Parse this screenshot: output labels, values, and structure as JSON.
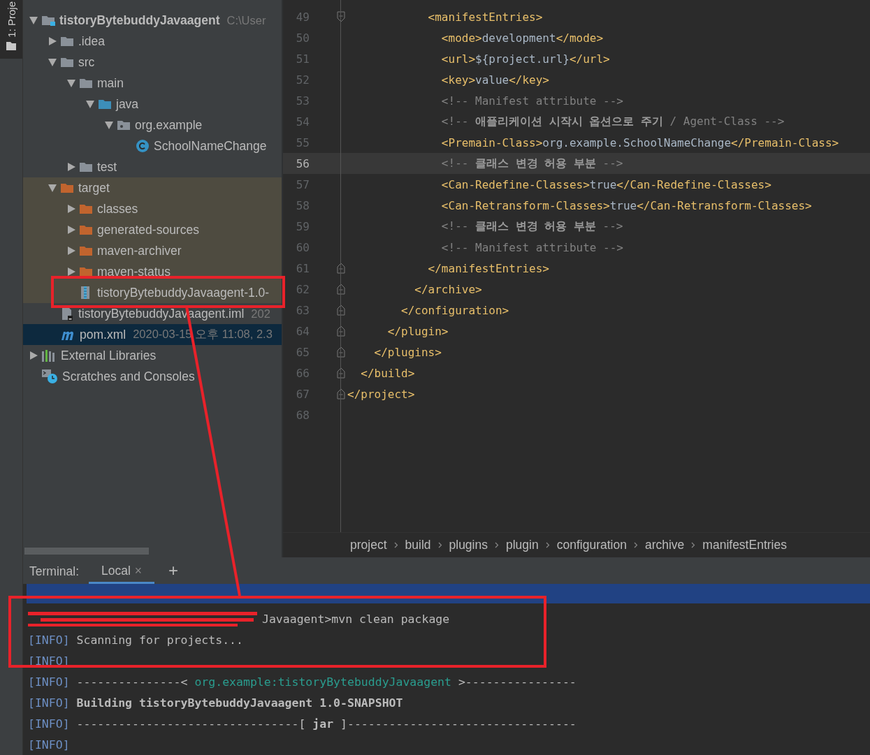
{
  "tool_stripe": {
    "label": "1: Proje"
  },
  "project_tree": [
    {
      "label": "tistoryBytebuddyJavaagent",
      "kind": "module",
      "hint": "C:\\User",
      "expanded": true,
      "selected": false,
      "excluded": false,
      "children": [
        {
          "label": ".idea",
          "kind": "folder",
          "expanded": false,
          "selected": false,
          "excluded": false
        },
        {
          "label": "src",
          "kind": "folder",
          "expanded": true,
          "selected": false,
          "excluded": false,
          "children": [
            {
              "label": "main",
              "kind": "folder",
              "expanded": true,
              "selected": false,
              "excluded": false,
              "children": [
                {
                  "label": "java",
                  "kind": "source",
                  "expanded": true,
                  "selected": false,
                  "excluded": false,
                  "children": [
                    {
                      "label": "org.example",
                      "kind": "package",
                      "expanded": true,
                      "selected": false,
                      "excluded": false,
                      "children": [
                        {
                          "label": "SchoolNameChange",
                          "kind": "class",
                          "selected": false,
                          "excluded": false
                        }
                      ]
                    }
                  ]
                }
              ]
            },
            {
              "label": "test",
              "kind": "folder",
              "expanded": false,
              "selected": false,
              "excluded": false
            }
          ]
        },
        {
          "label": "target",
          "kind": "folder",
          "expanded": true,
          "selected": false,
          "excluded": true,
          "children": [
            {
              "label": "classes",
              "kind": "folder",
              "expanded": false,
              "selected": false,
              "excluded": true
            },
            {
              "label": "generated-sources",
              "kind": "folder",
              "expanded": false,
              "selected": false,
              "excluded": true
            },
            {
              "label": "maven-archiver",
              "kind": "folder",
              "expanded": false,
              "selected": false,
              "excluded": true
            },
            {
              "label": "maven-status",
              "kind": "folder",
              "expanded": false,
              "selected": false,
              "excluded": true
            },
            {
              "label": "tistoryBytebuddyJavaagent-1.0-",
              "kind": "jar",
              "selected": false,
              "excluded": true
            }
          ]
        },
        {
          "label": "tistoryBytebuddyJavaagent.iml",
          "kind": "iml",
          "hint": "202",
          "selected": false,
          "excluded": false
        },
        {
          "label": "pom.xml",
          "kind": "maven",
          "hint": "2020-03-15 오후 11:08, 2.3",
          "selected": true,
          "excluded": false
        }
      ]
    },
    {
      "label": "External Libraries",
      "kind": "libraries",
      "expanded": false,
      "selected": false,
      "excluded": false
    },
    {
      "label": "Scratches and Consoles",
      "kind": "scratches",
      "selected": false,
      "excluded": false
    }
  ],
  "editor": {
    "lines": [
      {
        "number": "49",
        "fold_start": true,
        "fold_end": false,
        "current": false,
        "segments": [
          {
            "kind": "tag",
            "text": "            <manifestEntries>"
          }
        ]
      },
      {
        "number": "50",
        "fold_start": false,
        "fold_end": false,
        "current": false,
        "segments": [
          {
            "kind": "tag",
            "text": "              <mode>"
          },
          {
            "kind": "text",
            "text": "development"
          },
          {
            "kind": "tag",
            "text": "</mode>"
          }
        ]
      },
      {
        "number": "51",
        "fold_start": false,
        "fold_end": false,
        "current": false,
        "segments": [
          {
            "kind": "tag",
            "text": "              <url>"
          },
          {
            "kind": "text",
            "text": "${project.url}"
          },
          {
            "kind": "tag",
            "text": "</url>"
          }
        ]
      },
      {
        "number": "52",
        "fold_start": false,
        "fold_end": false,
        "current": false,
        "segments": [
          {
            "kind": "tag",
            "text": "              <key>"
          },
          {
            "kind": "text",
            "text": "value"
          },
          {
            "kind": "tag",
            "text": "</key>"
          }
        ]
      },
      {
        "number": "53",
        "fold_start": false,
        "fold_end": false,
        "current": false,
        "segments": [
          {
            "kind": "comment",
            "text": "              <!-- Manifest attribute -->"
          }
        ]
      },
      {
        "number": "54",
        "fold_start": false,
        "fold_end": false,
        "current": false,
        "segments": [
          {
            "kind": "comment",
            "text": "              <!-- **애플리케이션 시작시 옵션으로 주기** / Agent-Class -->"
          }
        ]
      },
      {
        "number": "55",
        "fold_start": false,
        "fold_end": false,
        "current": false,
        "segments": [
          {
            "kind": "tag",
            "text": "              <Premain-Class>"
          },
          {
            "kind": "text",
            "text": "org.example.SchoolNameChange"
          },
          {
            "kind": "tag",
            "text": "</Premain-Class>"
          }
        ]
      },
      {
        "number": "56",
        "fold_start": false,
        "fold_end": false,
        "current": true,
        "segments": [
          {
            "kind": "comment",
            "text": "              <!-- **클래스 변경 허용 부분** -->"
          }
        ]
      },
      {
        "number": "57",
        "fold_start": false,
        "fold_end": false,
        "current": false,
        "segments": [
          {
            "kind": "tag",
            "text": "              <Can-Redefine-Classes>"
          },
          {
            "kind": "text",
            "text": "true"
          },
          {
            "kind": "tag",
            "text": "</Can-Redefine-Classes>"
          }
        ]
      },
      {
        "number": "58",
        "fold_start": false,
        "fold_end": false,
        "current": false,
        "segments": [
          {
            "kind": "tag",
            "text": "              <Can-Retransform-Classes>"
          },
          {
            "kind": "text",
            "text": "true"
          },
          {
            "kind": "tag",
            "text": "</Can-Retransform-Classes>"
          }
        ]
      },
      {
        "number": "59",
        "fold_start": false,
        "fold_end": false,
        "current": false,
        "segments": [
          {
            "kind": "comment",
            "text": "              <!-- **클래스 변경 허용 부분** -->"
          }
        ]
      },
      {
        "number": "60",
        "fold_start": false,
        "fold_end": false,
        "current": false,
        "segments": [
          {
            "kind": "comment",
            "text": "              <!-- Manifest attribute -->"
          }
        ]
      },
      {
        "number": "61",
        "fold_start": false,
        "fold_end": true,
        "current": false,
        "segments": [
          {
            "kind": "tag",
            "text": "            </manifestEntries>"
          }
        ]
      },
      {
        "number": "62",
        "fold_start": false,
        "fold_end": true,
        "current": false,
        "segments": [
          {
            "kind": "tag",
            "text": "          </archive>"
          }
        ]
      },
      {
        "number": "63",
        "fold_start": false,
        "fold_end": true,
        "current": false,
        "segments": [
          {
            "kind": "tag",
            "text": "        </configuration>"
          }
        ]
      },
      {
        "number": "64",
        "fold_start": false,
        "fold_end": true,
        "current": false,
        "segments": [
          {
            "kind": "tag",
            "text": "      </plugin>"
          }
        ]
      },
      {
        "number": "65",
        "fold_start": false,
        "fold_end": true,
        "current": false,
        "segments": [
          {
            "kind": "tag",
            "text": "    </plugins>"
          }
        ]
      },
      {
        "number": "66",
        "fold_start": false,
        "fold_end": true,
        "current": false,
        "segments": [
          {
            "kind": "tag",
            "text": "  </build>"
          }
        ]
      },
      {
        "number": "67",
        "fold_start": false,
        "fold_end": true,
        "current": false,
        "segments": [
          {
            "kind": "tag",
            "text": "</project>"
          }
        ]
      },
      {
        "number": "68",
        "fold_start": false,
        "fold_end": false,
        "current": false
      }
    ],
    "breadcrumbs": [
      "project",
      "build",
      "plugins",
      "plugin",
      "configuration",
      "archive",
      "manifestEntries"
    ]
  },
  "terminal": {
    "label": "Terminal:",
    "tabs": [
      {
        "label": "Local",
        "selected": true,
        "close": "×"
      }
    ],
    "add": "+",
    "lines": [
      {
        "redacted": true,
        "segments": [
          {
            "kind": "plain",
            "text": "Javaagent>mvn clean package"
          }
        ]
      },
      {
        "redacted": false,
        "segments": [
          {
            "kind": "info",
            "text": "[INFO]"
          },
          {
            "kind": "plain",
            "text": " Scanning for projects..."
          }
        ]
      },
      {
        "redacted": false,
        "segments": [
          {
            "kind": "info",
            "text": "[INFO]"
          }
        ]
      },
      {
        "redacted": false,
        "segments": [
          {
            "kind": "info",
            "text": "[INFO]"
          },
          {
            "kind": "plain",
            "text": " ---------------< "
          },
          {
            "kind": "link",
            "text": "org.example:tistoryBytebuddyJavaagent"
          },
          {
            "kind": "plain",
            "text": " >----------------"
          }
        ]
      },
      {
        "redacted": false,
        "segments": [
          {
            "kind": "info",
            "text": "[INFO]"
          },
          {
            "kind": "bold",
            "text": " Building tistoryBytebuddyJavaagent 1.0-SNAPSHOT"
          }
        ]
      },
      {
        "redacted": false,
        "segments": [
          {
            "kind": "info",
            "text": "[INFO]"
          },
          {
            "kind": "plain",
            "text": " --------------------------------[ "
          },
          {
            "kind": "bold",
            "text": "jar"
          },
          {
            "kind": "plain",
            "text": " ]---------------------------------"
          }
        ]
      },
      {
        "redacted": false,
        "segments": [
          {
            "kind": "info",
            "text": "[INFO]"
          }
        ]
      }
    ]
  }
}
